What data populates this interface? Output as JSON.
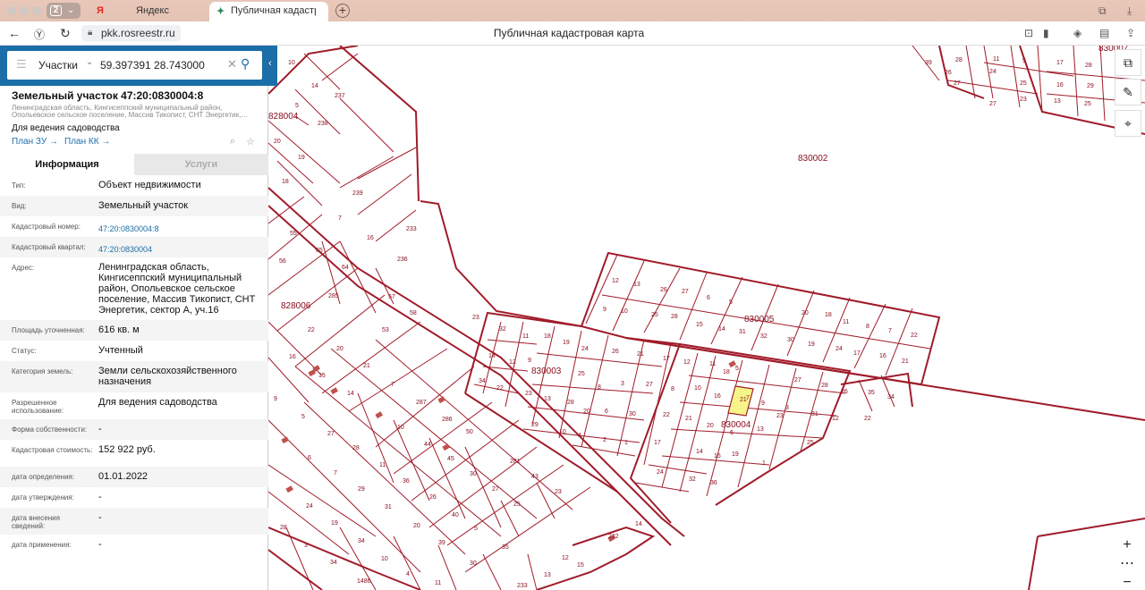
{
  "browser": {
    "tab_count": "2",
    "tabs": [
      {
        "icon": "Я",
        "label": "Яндекс"
      },
      {
        "icon": "✦",
        "label": "Публичная кадастров"
      }
    ],
    "url": "pkk.rosreestr.ru",
    "page_title": "Публичная кадастровая карта"
  },
  "search": {
    "type": "Участки",
    "query": "59.397391 28.743000"
  },
  "object": {
    "title": "Земельный участок 47:20:0830004:8",
    "address_line1": "Ленинградская область, Кингисеппский муниципальный район,",
    "address_line2": "Опольевское сельское поселение, Массив Тикопист, СНТ Энергетик,…",
    "use": "Для ведения садоводства",
    "plan_zu": "План ЗУ",
    "plan_kk": "План КК"
  },
  "tabs": {
    "info": "Информация",
    "services": "Услуги"
  },
  "props": [
    {
      "label": "Тип:",
      "value": "Объект недвижимости"
    },
    {
      "label": "Вид:",
      "value": "Земельный участок"
    },
    {
      "label": "Кадастровый номер:",
      "value": "47:20:0830004:8"
    },
    {
      "label": "Кадастровый квартал:",
      "value": "47:20:0830004"
    },
    {
      "label": "Адрес:",
      "value": "Ленинградская область, Кингисеппский муниципальный район, Опольевское сельское поселение, Массив Тикопист, СНТ Энергетик, сектор А, уч.16"
    },
    {
      "label": "Площадь уточненная:",
      "value": "616 кв. м"
    },
    {
      "label": "Статус:",
      "value": "Учтенный"
    },
    {
      "label": "Категория земель:",
      "value": "Земли сельскохозяйственного назначения"
    },
    {
      "label": "Разрешенное использование:",
      "value": "Для ведения садоводства"
    },
    {
      "label": "Форма собственности:",
      "value": "-"
    },
    {
      "label": "Кадастровая стоимость:",
      "value": "152 922 руб."
    },
    {
      "label": "дата определения:",
      "value": "01.01.2022"
    },
    {
      "label": "дата утверждения:",
      "value": "-"
    },
    {
      "label": "дата внесения сведений:",
      "value": "-"
    },
    {
      "label": "дата применения:",
      "value": "-"
    }
  ],
  "map": {
    "colors": {
      "boundary": "#a01c2a",
      "selected": "#f7f58a",
      "building": "#c0504d"
    },
    "quarter_labels": [
      "830002",
      "830005",
      "830003",
      "830004",
      "828004",
      "828006",
      "830007"
    ],
    "parcel_numbers": [
      "10",
      "14",
      "237",
      "5",
      "238",
      "20",
      "19",
      "18",
      "239",
      "7",
      "233",
      "16",
      "55",
      "65",
      "64",
      "236",
      "56",
      "285",
      "57",
      "58",
      "22",
      "53",
      "16",
      "20",
      "21",
      "15",
      "14",
      "9",
      "5",
      "7",
      "287",
      "286",
      "10",
      "27",
      "28",
      "44",
      "50",
      "6",
      "11",
      "45",
      "36",
      "7",
      "30",
      "281",
      "29",
      "26",
      "43",
      "27",
      "31",
      "23",
      "24",
      "19",
      "20",
      "40",
      "25",
      "28",
      "5",
      "34",
      "39",
      "35",
      "3",
      "10",
      "30",
      "34",
      "4",
      "11",
      "13",
      "12",
      "15",
      "233",
      "14",
      "232",
      "1486",
      "39",
      "28",
      "11",
      "5",
      "17",
      "28",
      "26",
      "24",
      "25",
      "16",
      "29",
      "27",
      "27",
      "23",
      "13",
      "25",
      "12",
      "13",
      "26",
      "27",
      "6",
      "5",
      "20",
      "18",
      "9",
      "10",
      "25",
      "28",
      "15",
      "14",
      "31",
      "32",
      "30",
      "19",
      "11",
      "8",
      "7",
      "22",
      "24",
      "17",
      "16",
      "21",
      "23",
      "32",
      "11",
      "18",
      "19",
      "14",
      "12",
      "9",
      "24",
      "26",
      "21",
      "17",
      "34",
      "22",
      "23",
      "13",
      "25",
      "8",
      "3",
      "27",
      "28",
      "20",
      "6",
      "30",
      "29",
      "10",
      "4",
      "2",
      "1",
      "12",
      "11",
      "5",
      "10",
      "16",
      "7",
      "9",
      "3",
      "8",
      "22",
      "21",
      "20",
      "6",
      "18",
      "27",
      "28",
      "26",
      "31",
      "12",
      "14",
      "15",
      "19",
      "17",
      "13",
      "23",
      "25",
      "24",
      "32",
      "36",
      "1",
      "35",
      "34",
      "22",
      "21",
      "39",
      "10",
      "15",
      "8"
    ]
  }
}
